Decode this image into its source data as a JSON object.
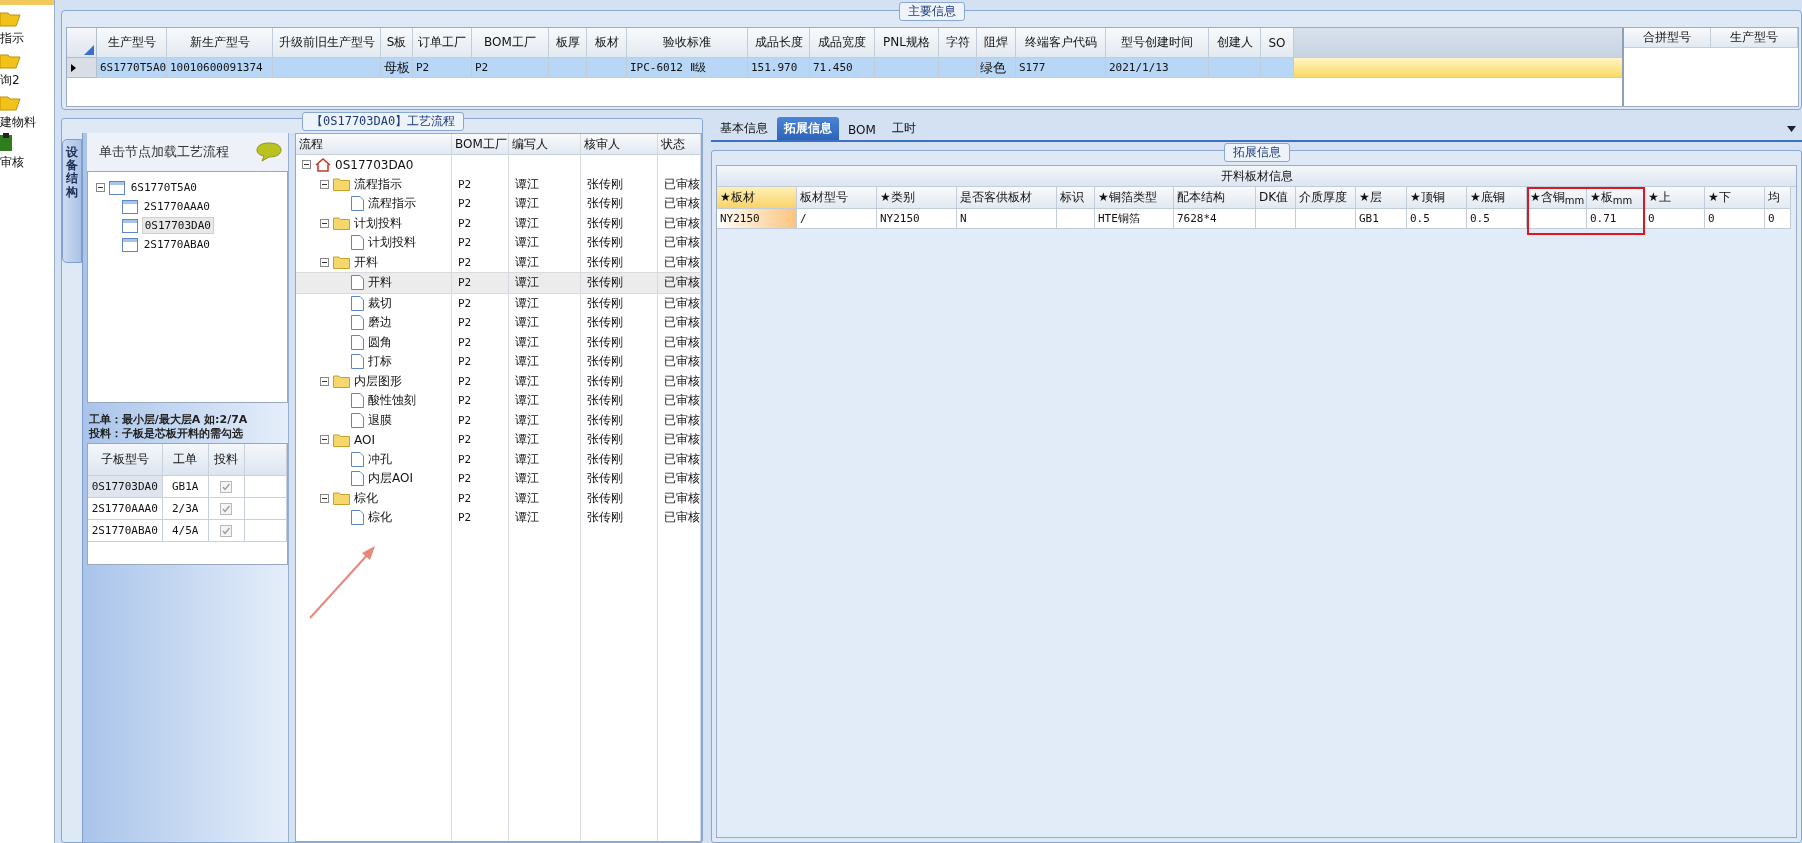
{
  "launcher": {
    "items": [
      {
        "label": "指示",
        "kind": "folder"
      },
      {
        "label": "询2",
        "kind": "folder"
      },
      {
        "label": "建物料",
        "kind": "folder"
      },
      {
        "label": "审核",
        "kind": "check"
      }
    ]
  },
  "main_info": {
    "title": "主要信息",
    "columns": [
      "生产型号",
      "新生产型号",
      "升级前旧生产型号",
      "S板",
      "订单工厂",
      "BOM工厂",
      "板厚",
      "板材",
      "验收标准",
      "成品长度",
      "成品宽度",
      "PNL规格",
      "字符",
      "阻焊",
      "终端客户代码",
      "型号创建时间",
      "创建人",
      "SO"
    ],
    "rows": [
      {
        "selected": true,
        "cells": [
          "6S1770T5A0",
          "10010600091374",
          null,
          "母板",
          "P2",
          "P2",
          null,
          null,
          "IPC-6012 Ⅱ级",
          "151.970",
          "71.450",
          null,
          null,
          "绿色",
          "S177",
          "2021/1/13",
          null,
          null
        ]
      }
    ],
    "merge_table": {
      "columns": [
        "合拼型号",
        "生产型号"
      ]
    }
  },
  "process": {
    "title": "【0S17703DA0】工艺流程",
    "side_tab": "设备结构",
    "hint_header": "单击节点加载工艺流程",
    "board_tree": [
      {
        "name": "6S1770T5A0",
        "expanded": true,
        "selected": false,
        "children": [
          {
            "name": "2S1770AAA0",
            "selected": false
          },
          {
            "name": "0S17703DA0",
            "selected": true
          },
          {
            "name": "2S1770ABA0",
            "selected": false
          }
        ]
      }
    ],
    "notes": [
      "工单：最小层/最大层A 如:2/7A",
      "投料：子板是芯板开料的需勾选"
    ],
    "sub_boards": {
      "columns": [
        "子板型号",
        "工单",
        "投料"
      ],
      "rows": [
        {
          "model": "0S17703DA0",
          "order": "GB1A",
          "feed": true,
          "selected": true
        },
        {
          "model": "2S1770AAA0",
          "order": "2/3A",
          "feed": true,
          "selected": false
        },
        {
          "model": "2S1770ABA0",
          "order": "4/5A",
          "feed": true,
          "selected": false
        }
      ]
    },
    "columns": [
      "流程",
      "BOM工厂",
      "编写人",
      "核审人",
      "状态"
    ],
    "tree": [
      {
        "name": "0S17703DA0",
        "kind": "root",
        "expanded": true,
        "selected": false,
        "children": [
          {
            "name": "流程指示",
            "kind": "folder",
            "bom": "P2",
            "writer": "谭江",
            "reviewer": "张传刚",
            "status": "已审核",
            "expanded": true,
            "selected": false,
            "children": [
              {
                "name": "流程指示",
                "kind": "step",
                "bom": "P2",
                "writer": "谭江",
                "reviewer": "张传刚",
                "status": "已审核",
                "selected": false
              }
            ]
          },
          {
            "name": "计划投料",
            "kind": "folder",
            "bom": "P2",
            "writer": "谭江",
            "reviewer": "张传刚",
            "status": "已审核",
            "expanded": true,
            "selected": false,
            "children": [
              {
                "name": "计划投料",
                "kind": "step",
                "bom": "P2",
                "writer": "谭江",
                "reviewer": "张传刚",
                "status": "已审核",
                "selected": false
              }
            ]
          },
          {
            "name": "开料",
            "kind": "folder",
            "bom": "P2",
            "writer": "谭江",
            "reviewer": "张传刚",
            "status": "已审核",
            "expanded": true,
            "selected": false,
            "children": [
              {
                "name": "开料",
                "kind": "step",
                "bom": "P2",
                "writer": "谭江",
                "reviewer": "张传刚",
                "status": "已审核",
                "selected": true
              },
              {
                "name": "裁切",
                "kind": "step",
                "bom": "P2",
                "writer": "谭江",
                "reviewer": "张传刚",
                "status": "已审核",
                "selected": false
              },
              {
                "name": "磨边",
                "kind": "step",
                "bom": "P2",
                "writer": "谭江",
                "reviewer": "张传刚",
                "status": "已审核",
                "selected": false
              },
              {
                "name": "圆角",
                "kind": "step",
                "bom": "P2",
                "writer": "谭江",
                "reviewer": "张传刚",
                "status": "已审核",
                "selected": false
              },
              {
                "name": "打标",
                "kind": "step",
                "bom": "P2",
                "writer": "谭江",
                "reviewer": "张传刚",
                "status": "已审核",
                "selected": false
              }
            ]
          },
          {
            "name": "内层图形",
            "kind": "folder",
            "bom": "P2",
            "writer": "谭江",
            "reviewer": "张传刚",
            "status": "已审核",
            "expanded": true,
            "selected": false,
            "children": [
              {
                "name": "酸性蚀刻",
                "kind": "step",
                "bom": "P2",
                "writer": "谭江",
                "reviewer": "张传刚",
                "status": "已审核",
                "selected": false
              },
              {
                "name": "退膜",
                "kind": "step",
                "bom": "P2",
                "writer": "谭江",
                "reviewer": "张传刚",
                "status": "已审核",
                "selected": false
              }
            ]
          },
          {
            "name": "AOI",
            "kind": "folder",
            "bom": "P2",
            "writer": "谭江",
            "reviewer": "张传刚",
            "status": "已审核",
            "expanded": true,
            "selected": false,
            "children": [
              {
                "name": "冲孔",
                "kind": "step",
                "bom": "P2",
                "writer": "谭江",
                "reviewer": "张传刚",
                "status": "已审核",
                "selected": false
              },
              {
                "name": "内层AOI",
                "kind": "step",
                "bom": "P2",
                "writer": "谭江",
                "reviewer": "张传刚",
                "status": "已审核",
                "selected": false
              }
            ]
          },
          {
            "name": "棕化",
            "kind": "folder",
            "bom": "P2",
            "writer": "谭江",
            "reviewer": "张传刚",
            "status": "已审核",
            "expanded": true,
            "selected": false,
            "children": [
              {
                "name": "棕化",
                "kind": "step",
                "bom": "P2",
                "writer": "谭江",
                "reviewer": "张传刚",
                "status": "已审核",
                "selected": false
              }
            ]
          }
        ]
      }
    ]
  },
  "details": {
    "tabs": [
      {
        "label": "基本信息",
        "selected": false
      },
      {
        "label": "拓展信息",
        "selected": true
      },
      {
        "label": "BOM",
        "selected": false
      },
      {
        "label": "工时",
        "selected": false
      }
    ],
    "group_title": "拓展信息",
    "grid_title": "开料板材信息",
    "columns": [
      {
        "label": "★板材",
        "selected": true,
        "highlighted": false
      },
      {
        "label": "板材型号",
        "selected": false,
        "highlighted": false
      },
      {
        "label": "★类别",
        "selected": false,
        "highlighted": false
      },
      {
        "label": "是否客供板材",
        "selected": false,
        "highlighted": false
      },
      {
        "label": "标识",
        "selected": false,
        "highlighted": false
      },
      {
        "label": "★铜箔类型",
        "selected": false,
        "highlighted": false
      },
      {
        "label": "配本结构",
        "selected": false,
        "highlighted": false
      },
      {
        "label": "DK值",
        "selected": false,
        "highlighted": false
      },
      {
        "label": "介质厚度",
        "selected": false,
        "highlighted": false
      },
      {
        "label": "★层",
        "selected": false,
        "highlighted": false
      },
      {
        "label": "★顶铜",
        "selected": false,
        "highlighted": false
      },
      {
        "label": "★底铜",
        "selected": false,
        "highlighted": false
      },
      {
        "label": "★含铜$_{mm}$",
        "selected": false,
        "highlighted": true
      },
      {
        "label": "★板$_{mm}$",
        "selected": false,
        "highlighted": true
      },
      {
        "label": "★上",
        "selected": false,
        "highlighted": false
      },
      {
        "label": "★下",
        "selected": false,
        "highlighted": false
      },
      {
        "label": "均",
        "selected": false,
        "highlighted": false
      }
    ],
    "rows": [
      {
        "cells": [
          "NY2150",
          "/",
          "NY2150",
          "N",
          null,
          "HTE铜箔",
          "7628*4",
          null,
          null,
          "GB1",
          "0.5",
          "0.5",
          null,
          "0.71",
          "0",
          "0",
          "0"
        ]
      }
    ]
  }
}
